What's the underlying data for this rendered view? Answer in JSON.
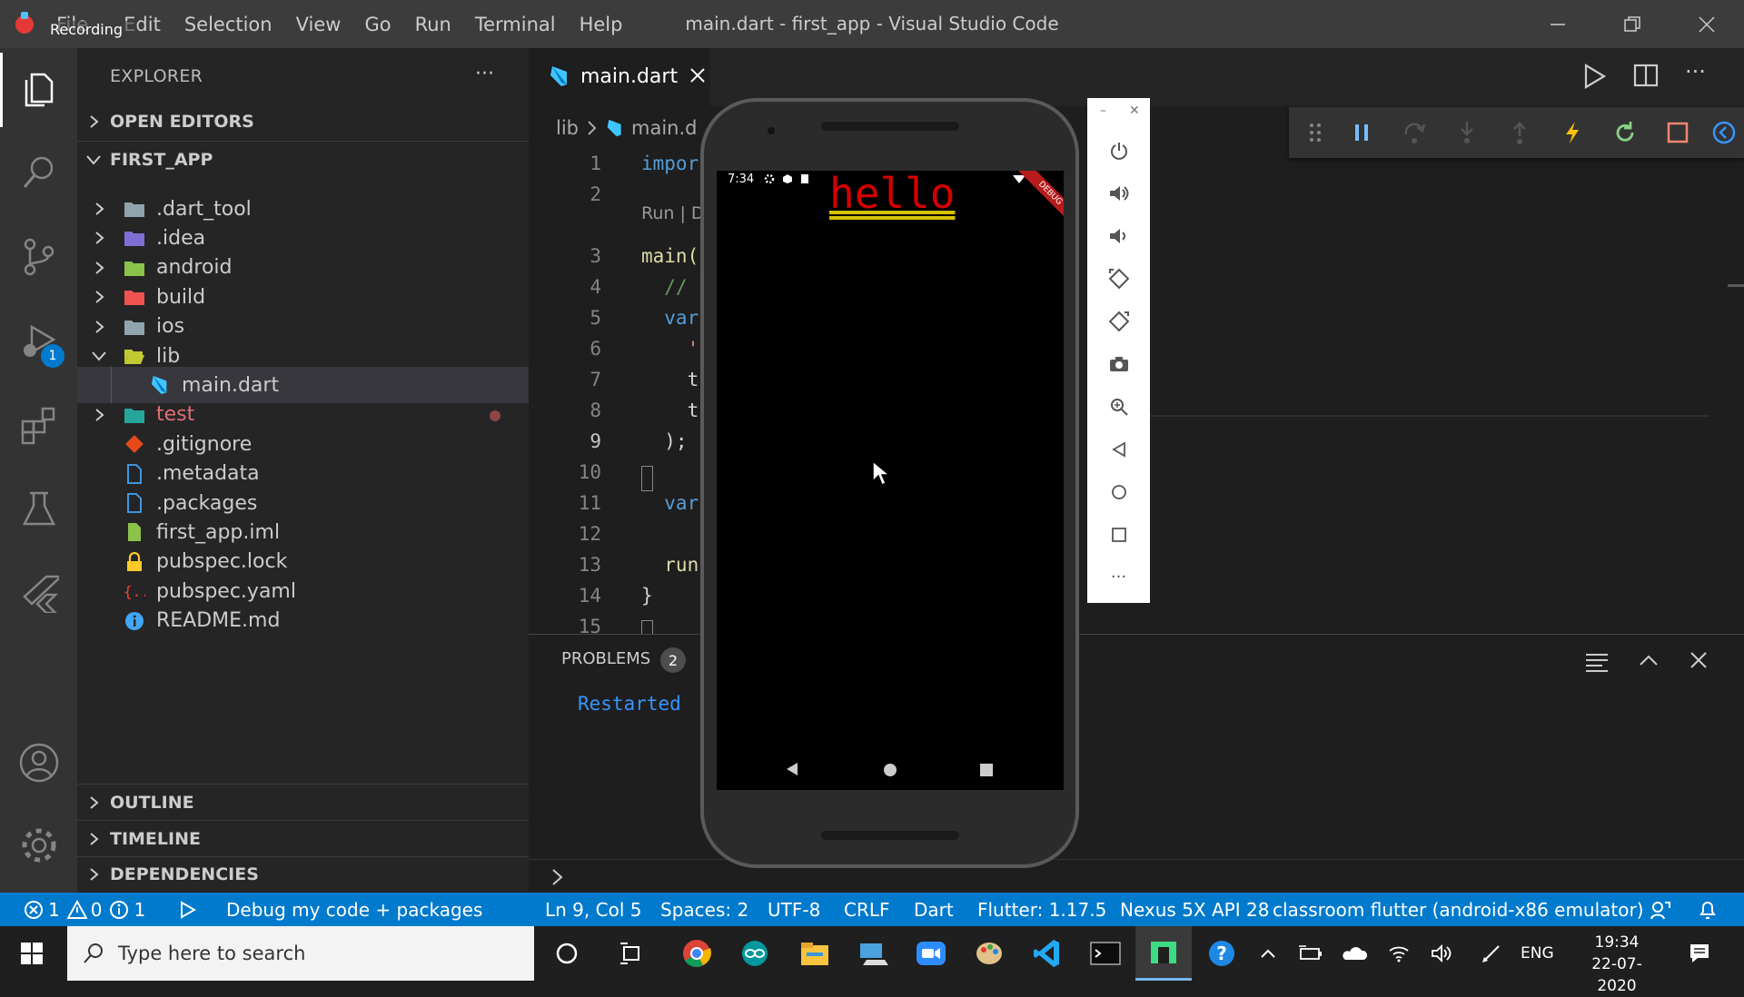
{
  "window": {
    "title": "main.dart - first_app - Visual Studio Code",
    "recording_label": "Recording",
    "menu": [
      "File",
      "Edit",
      "Selection",
      "View",
      "Go",
      "Run",
      "Terminal",
      "Help"
    ]
  },
  "activity_bar": {
    "items": [
      "files-icon",
      "search-icon",
      "source-control-icon",
      "run-debug-icon",
      "extensions-icon",
      "testing-icon",
      "flutter-icon"
    ],
    "debug_badge": "1",
    "bottom": [
      "account-icon",
      "gear-icon"
    ]
  },
  "sidebar": {
    "title": "EXPLORER",
    "open_editors": "OPEN EDITORS",
    "project": "FIRST_APP",
    "tree": [
      {
        "label": "ide.dart_tool",
        "text": ".dart_tool",
        "type": "folder",
        "color": "#90a4ae"
      },
      {
        "text": ".idea",
        "type": "folder",
        "color": "#7e6fd4"
      },
      {
        "text": "android",
        "type": "folder",
        "color": "#8bc34a"
      },
      {
        "text": "build",
        "type": "folder",
        "color": "#ef5350"
      },
      {
        "text": "ios",
        "type": "folder",
        "color": "#90a4ae"
      },
      {
        "text": "lib",
        "type": "folder-open",
        "color": "#c0ca33"
      },
      {
        "text": "main.dart",
        "type": "dart",
        "color": "#40c4ff"
      },
      {
        "text": "test",
        "type": "folder",
        "color": "#26a69a",
        "modified": true
      },
      {
        "text": ".gitignore",
        "type": "git",
        "color": "#e64a19"
      },
      {
        "text": ".metadata",
        "type": "file",
        "color": "#42a5f5"
      },
      {
        "text": ".packages",
        "type": "file",
        "color": "#42a5f5"
      },
      {
        "text": "first_app.iml",
        "type": "iml",
        "color": "#8bc34a"
      },
      {
        "text": "pubspec.lock",
        "type": "lock",
        "color": "#ffca28"
      },
      {
        "text": "pubspec.yaml",
        "type": "yaml",
        "color": "#f44336"
      },
      {
        "text": "README.md",
        "type": "info",
        "color": "#42a5f5"
      }
    ],
    "sections": [
      "OUTLINE",
      "TIMELINE",
      "DEPENDENCIES"
    ]
  },
  "editor": {
    "tab": "main.dart",
    "breadcrumb": [
      "lib",
      "main.d"
    ],
    "codelens": "Run | D",
    "lines": [
      {
        "n": "1",
        "text": "impor",
        "color": "#569cd6"
      },
      {
        "n": "2",
        "text": "",
        "color": "#d4d4d4"
      },
      {
        "n": "3",
        "text": "main(",
        "color": "#dcdcaa"
      },
      {
        "n": "4",
        "text": "  //",
        "color": "#6a9955"
      },
      {
        "n": "5",
        "text": "  var",
        "color": "#569cd6"
      },
      {
        "n": "6",
        "text": "    '",
        "color": "#ce9178"
      },
      {
        "n": "7",
        "text": "    t",
        "color": "#d4d4d4"
      },
      {
        "n": "8",
        "text": "    t",
        "color": "#d4d4d4"
      },
      {
        "n": "9",
        "text": "  );",
        "color": "#d4d4d4"
      },
      {
        "n": "10",
        "text": "",
        "color": "#d4d4d4"
      },
      {
        "n": "11",
        "text": "  var",
        "color": "#569cd6"
      },
      {
        "n": "12",
        "text": "",
        "color": "#d4d4d4"
      },
      {
        "n": "13",
        "text": "  run",
        "color": "#dcdcaa"
      },
      {
        "n": "14",
        "text": "}",
        "color": "#d4d4d4"
      },
      {
        "n": "15",
        "text": "",
        "color": "#d4d4d4"
      }
    ]
  },
  "panel": {
    "tab": "PROBLEMS",
    "count": "2",
    "output": "Restarted"
  },
  "statusbar": {
    "errors": "1",
    "warnings": "0",
    "infos": "1",
    "debug_config": "Debug my code + packages",
    "position": "Ln 9, Col 5",
    "spaces": "Spaces: 2",
    "encoding": "UTF-8",
    "eol": "CRLF",
    "language": "Dart",
    "flutter": "Flutter: 1.17.5",
    "device": "Nexus 5X API 28",
    "emulator": "classroom flutter (android-x86 emulator)"
  },
  "emulator": {
    "time": "7:34",
    "app_text": "hello",
    "app_text_color": "#d50000",
    "debug_banner": "DEBUG",
    "tools": [
      "power-icon",
      "volume-up-icon",
      "volume-down-icon",
      "rotate-left-icon",
      "rotate-right-icon",
      "camera-icon",
      "zoom-icon",
      "back-icon",
      "home-icon",
      "overview-icon",
      "more-icon"
    ]
  },
  "debug_toolbar": [
    "drag-handle-icon",
    "pause-icon",
    "step-over-icon",
    "step-into-icon",
    "step-out-icon",
    "hot-reload-icon",
    "hot-restart-icon",
    "stop-icon",
    "devtools-icon"
  ],
  "taskbar": {
    "search_placeholder": "Type here to search",
    "language": "ENG",
    "time": "19:34",
    "date": "22-07-2020"
  },
  "colors": {
    "accent": "#007acc",
    "titlebar": "#3c3c3c",
    "sidebar": "#252526",
    "editor": "#1e1e1e"
  }
}
